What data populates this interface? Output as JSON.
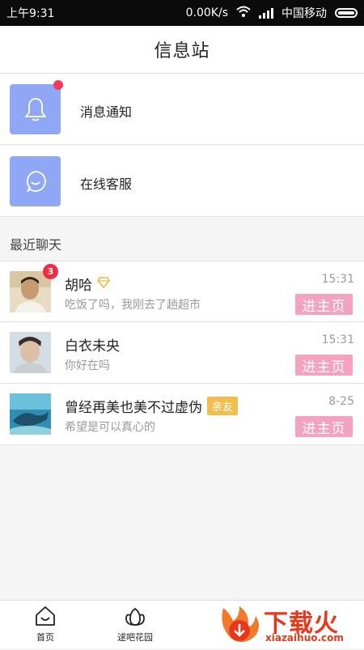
{
  "status_bar": {
    "time": "上午9:31",
    "net_speed": "0.00K/s",
    "carrier": "中国移动"
  },
  "header": {
    "title": "信息站"
  },
  "notices": [
    {
      "label": "消息通知",
      "icon": "bell-icon",
      "has_dot": true
    },
    {
      "label": "在线客服",
      "icon": "chat-bubble-icon",
      "has_dot": false
    }
  ],
  "recent_label": "最近聊天",
  "chats": [
    {
      "name": "胡哈",
      "message": "吃饭了吗，我刚去了趟超市",
      "time": "15:31",
      "badge": "3",
      "button": "进主页",
      "vip_icon": "diamond-icon"
    },
    {
      "name": "白衣未央",
      "message": "你好在吗",
      "time": "15:31",
      "button": "进主页"
    },
    {
      "name": "曾经再美也美不过虚伪",
      "tag": "亲友",
      "message": "希望是可以真心的",
      "time": "8-25",
      "button": "进主页"
    }
  ],
  "bottom_nav": [
    {
      "label": "首页",
      "icon": "home-icon"
    },
    {
      "label": "逑吧花园",
      "icon": "tulip-icon"
    }
  ],
  "watermark": {
    "text": "下载火",
    "url": "xiazaihuo.com"
  },
  "colors": {
    "icon_bg": "#8fa7f4",
    "button_pink": "#f4a3bf",
    "badge_red": "#ef2d44",
    "tag_yellow": "#f1bd4d"
  }
}
